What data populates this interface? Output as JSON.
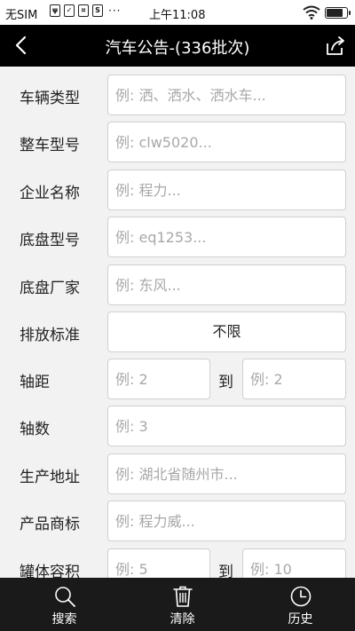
{
  "status": {
    "carrier": "无SIM",
    "system_icons": [
      "usb-icon",
      "notification-icon",
      "sd-card-icon",
      "sync-icon"
    ],
    "more": "···",
    "time": "上午11:08",
    "battery_level": 0.85
  },
  "nav": {
    "title": "汽车公告-(336批次)"
  },
  "form": {
    "vehicle_type": {
      "label": "车辆类型",
      "placeholder": "例: 洒、洒水、洒水车..."
    },
    "vehicle_model": {
      "label": "整车型号",
      "placeholder": "例: clw5020..."
    },
    "company_name": {
      "label": "企业名称",
      "placeholder": "例: 程力..."
    },
    "chassis_model": {
      "label": "底盘型号",
      "placeholder": "例: eq1253..."
    },
    "chassis_maker": {
      "label": "底盘厂家",
      "placeholder": "例: 东风..."
    },
    "emission_standard": {
      "label": "排放标准",
      "value": "不限"
    },
    "wheelbase": {
      "label": "轴距",
      "from_placeholder": "例: 2",
      "to_label": "到",
      "to_placeholder": "例: 2"
    },
    "axle_count": {
      "label": "轴数",
      "placeholder": "例: 3"
    },
    "production_address": {
      "label": "生产地址",
      "placeholder": "例: 湖北省随州市..."
    },
    "brand": {
      "label": "产品商标",
      "placeholder": "例: 程力威..."
    },
    "tank_volume": {
      "label": "罐体容积",
      "from_placeholder": "例: 5",
      "to_label": "到",
      "to_placeholder": "例: 10"
    }
  },
  "tabs": {
    "search": "搜索",
    "clear": "清除",
    "history": "历史"
  },
  "colors": {
    "nav_background": "#000000",
    "tab_background": "#1a1a1a",
    "page_background": "#f2f2f2"
  }
}
